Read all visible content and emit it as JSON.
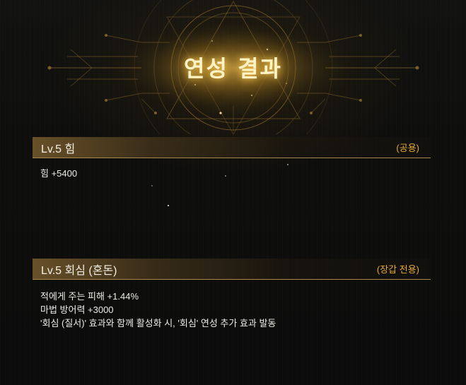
{
  "title": "연성 결과",
  "sections": [
    {
      "title": "Lv.5 힘",
      "tag": "(공용)",
      "lines": [
        "힘 +5400"
      ]
    },
    {
      "title": "Lv.5 회심 (혼돈)",
      "tag": "(장갑 전용)",
      "lines": [
        "적에게 주는 피해 +1.44%",
        "마법 방어력 +3000",
        "'회심 (질서)' 효과와 함께 활성화 시, '회심' 연성 추가 효과 발동"
      ]
    }
  ],
  "colors": {
    "accent_gold": "#e8a935",
    "title_glow": "#ffd25a",
    "header_line": "#a8874a"
  },
  "icons": [
    "ornamental-emblem"
  ]
}
